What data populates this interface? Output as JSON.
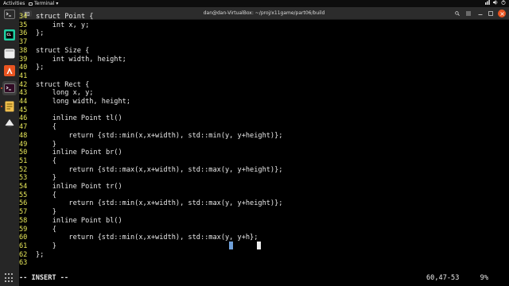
{
  "topbar": {
    "activities": "Activities",
    "app_name": "Terminal",
    "app_menu_arrow": "▾",
    "datetime": ""
  },
  "window": {
    "title": "dan@dan-VirtualBox: ~/proj/x11game/part06/build"
  },
  "editor": {
    "lines": [
      {
        "num": "34",
        "text": "struct Point {"
      },
      {
        "num": "35",
        "text": "    int x, y;"
      },
      {
        "num": "36",
        "text": "};"
      },
      {
        "num": "37",
        "text": ""
      },
      {
        "num": "38",
        "text": "struct Size {"
      },
      {
        "num": "39",
        "text": "    int width, height;"
      },
      {
        "num": "40",
        "text": "};"
      },
      {
        "num": "41",
        "text": ""
      },
      {
        "num": "42",
        "text": "struct Rect {"
      },
      {
        "num": "43",
        "text": "    long x, y;"
      },
      {
        "num": "44",
        "text": "    long width, height;"
      },
      {
        "num": "45",
        "text": ""
      },
      {
        "num": "46",
        "text": "    inline Point tl()"
      },
      {
        "num": "47",
        "text": "    {"
      },
      {
        "num": "48",
        "text": "        return {std::min(x,x+width), std::min(y, y+height)};"
      },
      {
        "num": "49",
        "text": "    }"
      },
      {
        "num": "50",
        "text": "    inline Point br()"
      },
      {
        "num": "51",
        "text": "    {"
      },
      {
        "num": "52",
        "text": "        return {std::max(x,x+width), std::max(y, y+height)};"
      },
      {
        "num": "53",
        "text": "    }"
      },
      {
        "num": "54",
        "text": "    inline Point tr()"
      },
      {
        "num": "55",
        "text": "    {"
      },
      {
        "num": "56",
        "text": "        return {std::min(x,x+width), std::max(y, y+height)};"
      },
      {
        "num": "57",
        "text": "    }"
      },
      {
        "num": "58",
        "text": "    inline Point bl()"
      },
      {
        "num": "59",
        "text": "    {"
      },
      {
        "num": "60",
        "text": "        return {std::min(x,x+width), std::max(y, y+h};"
      },
      {
        "num": "61",
        "text": "    }"
      },
      {
        "num": "62",
        "text": "};"
      },
      {
        "num": "63",
        "text": ""
      }
    ],
    "mode": "-- INSERT --",
    "cursor_position": "60,47-53",
    "scroll_percent": "9%"
  },
  "colors": {
    "line_number": "#e8e85a",
    "text": "#e9e9e9",
    "background": "#000000",
    "dock": "#262626",
    "accent": "#e95420"
  },
  "dock": {
    "icons": [
      "terminal-icon",
      "jetbrains-icon",
      "files-icon",
      "app-center-icon",
      "terminal-active-icon",
      "text-editor-icon",
      "inkscape-icon",
      "show-apps-icon"
    ]
  }
}
